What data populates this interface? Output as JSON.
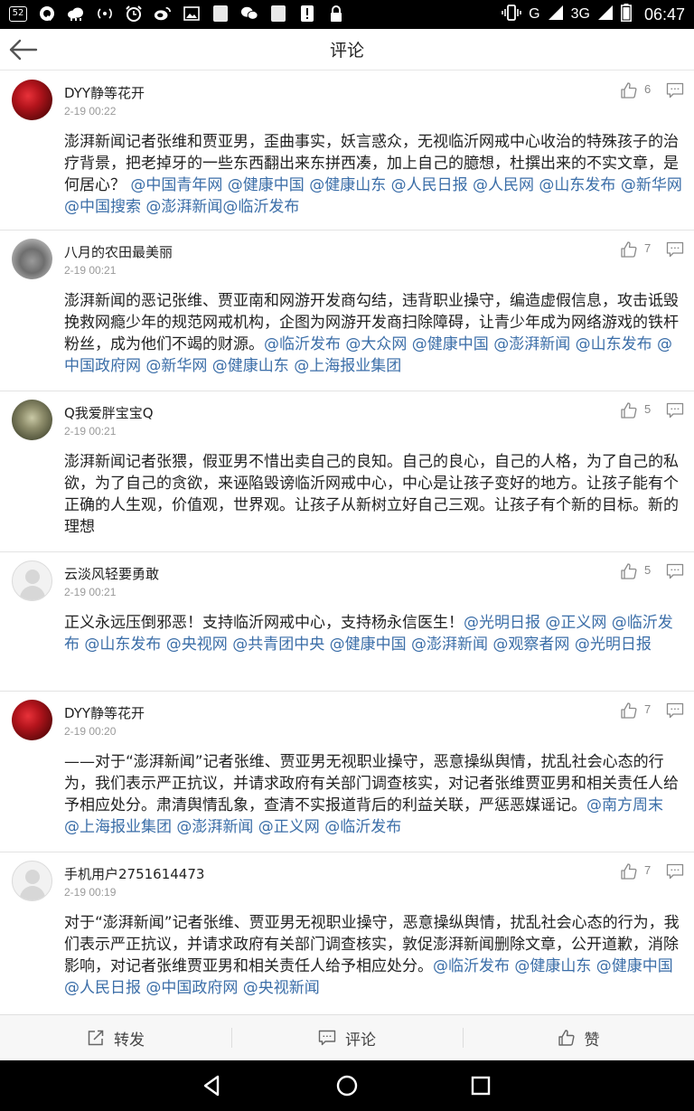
{
  "status_bar": {
    "left_badge": "52",
    "left_icons": [
      "notification-badge-icon",
      "q-app-icon",
      "cloud-icon",
      "wifi-hotspot-icon",
      "alarm-icon",
      "weibo-icon",
      "image-icon",
      "blank-notification-icon",
      "wechat-icon",
      "blank-notification-icon",
      "alert-icon",
      "lock-icon"
    ],
    "network_g": "G",
    "network_3g": "3G",
    "time": "06:47"
  },
  "header": {
    "title": "评论"
  },
  "comments": [
    {
      "user": "DYY静等花开",
      "time": "2-19 00:22",
      "likes": "6",
      "avatar": "rose",
      "text": "澎湃新闻记者张维和贾亚男，歪曲事实，妖言惑众，无视临沂网戒中心收治的特殊孩子的治疗背景，把老掉牙的一些东西翻出来东拼西凑，加上自己的臆想，杜撰出来的不实文章，是何居心？",
      "mentions": "@中国青年网 @健康中国 @健康山东 @人民日报 @人民网 @山东发布 @新华网 @中国搜索 @澎湃新闻@临沂发布"
    },
    {
      "user": "八月的农田最美丽",
      "time": "2-19 00:21",
      "likes": "7",
      "avatar": "grey",
      "text": "澎湃新闻的恶记张维、贾亚南和网游开发商勾结，违背职业操守，编造虚假信息，攻击诋毁挽救网瘾少年的规范网戒机构，企图为网游开发商扫除障碍，让青少年成为网络游戏的铁杆粉丝，成为他们不竭的财源。",
      "mentions": "@临沂发布 @大众网 @健康中国 @澎湃新闻 @山东发布 @中国政府网 @新华网 @健康山东 @上海报业集团"
    },
    {
      "user": "Q我爱胖宝宝Q",
      "time": "2-19 00:21",
      "likes": "5",
      "avatar": "bear",
      "text": "澎湃新闻记者张猥，假亚男不惜出卖自己的良知。自己的良心，自己的人格，为了自己的私欲，为了自己的贪欲，来诬陷毁谤临沂网戒中心，中心是让孩子变好的地方。让孩子能有个正确的人生观，价值观，世界观。让孩子从新树立好自己三观。让孩子有个新的目标。新的理想",
      "mentions": ""
    },
    {
      "user": "云淡风轻要勇敢",
      "time": "2-19 00:21",
      "likes": "5",
      "avatar": "default",
      "text": "正义永远压倒邪恶！支持临沂网戒中心，支持杨永信医生！",
      "mentions": "@光明日报 @正义网 @临沂发布 @山东发布 @央视网 @共青团中央  @健康中国 @澎湃新闻 @观察者网 @光明日报"
    },
    {
      "user": "DYY静等花开",
      "time": "2-19 00:20",
      "likes": "7",
      "avatar": "rose",
      "text": "——对于“澎湃新闻”记者张维、贾亚男无视职业操守，恶意操纵舆情，扰乱社会心态的行为，我们表示严正抗议，并请求政府有关部门调查核实，对记者张维贾亚男和相关责任人给予相应处分。肃清舆情乱象，查清不实报道背后的利益关联，严惩恶媒谣记。",
      "mentions": "@南方周末 @上海报业集团 @澎湃新闻 @正义网 @临沂发布"
    },
    {
      "user": "手机用户2751614473",
      "time": "2-19 00:19",
      "likes": "7",
      "avatar": "default",
      "text": "对于“澎湃新闻”记者张维、贾亚男无视职业操守，恶意操纵舆情，扰乱社会心态的行为，我们表示严正抗议，并请求政府有关部门调查核实，敦促澎湃新闻删除文章，公开道歉，消除影响，对记者张维贾亚男和相关责任人给予相应处分。",
      "mentions": "@临沂发布 @健康山东 @健康中国 @人民日报 @中国政府网 @央视新闻"
    }
  ],
  "actions": {
    "forward": "转发",
    "comment": "评论",
    "like": "赞"
  }
}
